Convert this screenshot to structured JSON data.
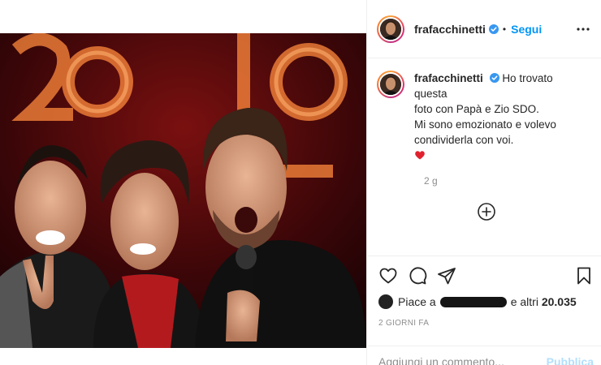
{
  "post": {
    "username": "frafacchinetti",
    "follow_label": "Segui",
    "verified_icon": "verified-badge-icon",
    "more_icon": "more-options-icon"
  },
  "caption": {
    "username": "frafacchinetti",
    "lines": [
      "Ho trovato questa",
      "foto con Papà e Zio SDO.",
      "Mi sono emozionato e volevo",
      "condividerla con voi."
    ],
    "emoji": "red-heart-emoji",
    "time_ago": "2 g"
  },
  "actions": {
    "icons": [
      "heart-icon",
      "comment-icon",
      "share-icon",
      "bookmark-icon"
    ]
  },
  "likes": {
    "prefix": "Piace a",
    "suffix": "e altri",
    "count": "20.035"
  },
  "date": "2 GIORNI FA",
  "comment": {
    "placeholder": "Aggiungi un commento...",
    "publish_label": "Pubblica"
  },
  "colors": {
    "accent": "#0095f6",
    "publish_disabled": "#b2dffc",
    "muted": "#8e8e8e",
    "text": "#262626"
  }
}
